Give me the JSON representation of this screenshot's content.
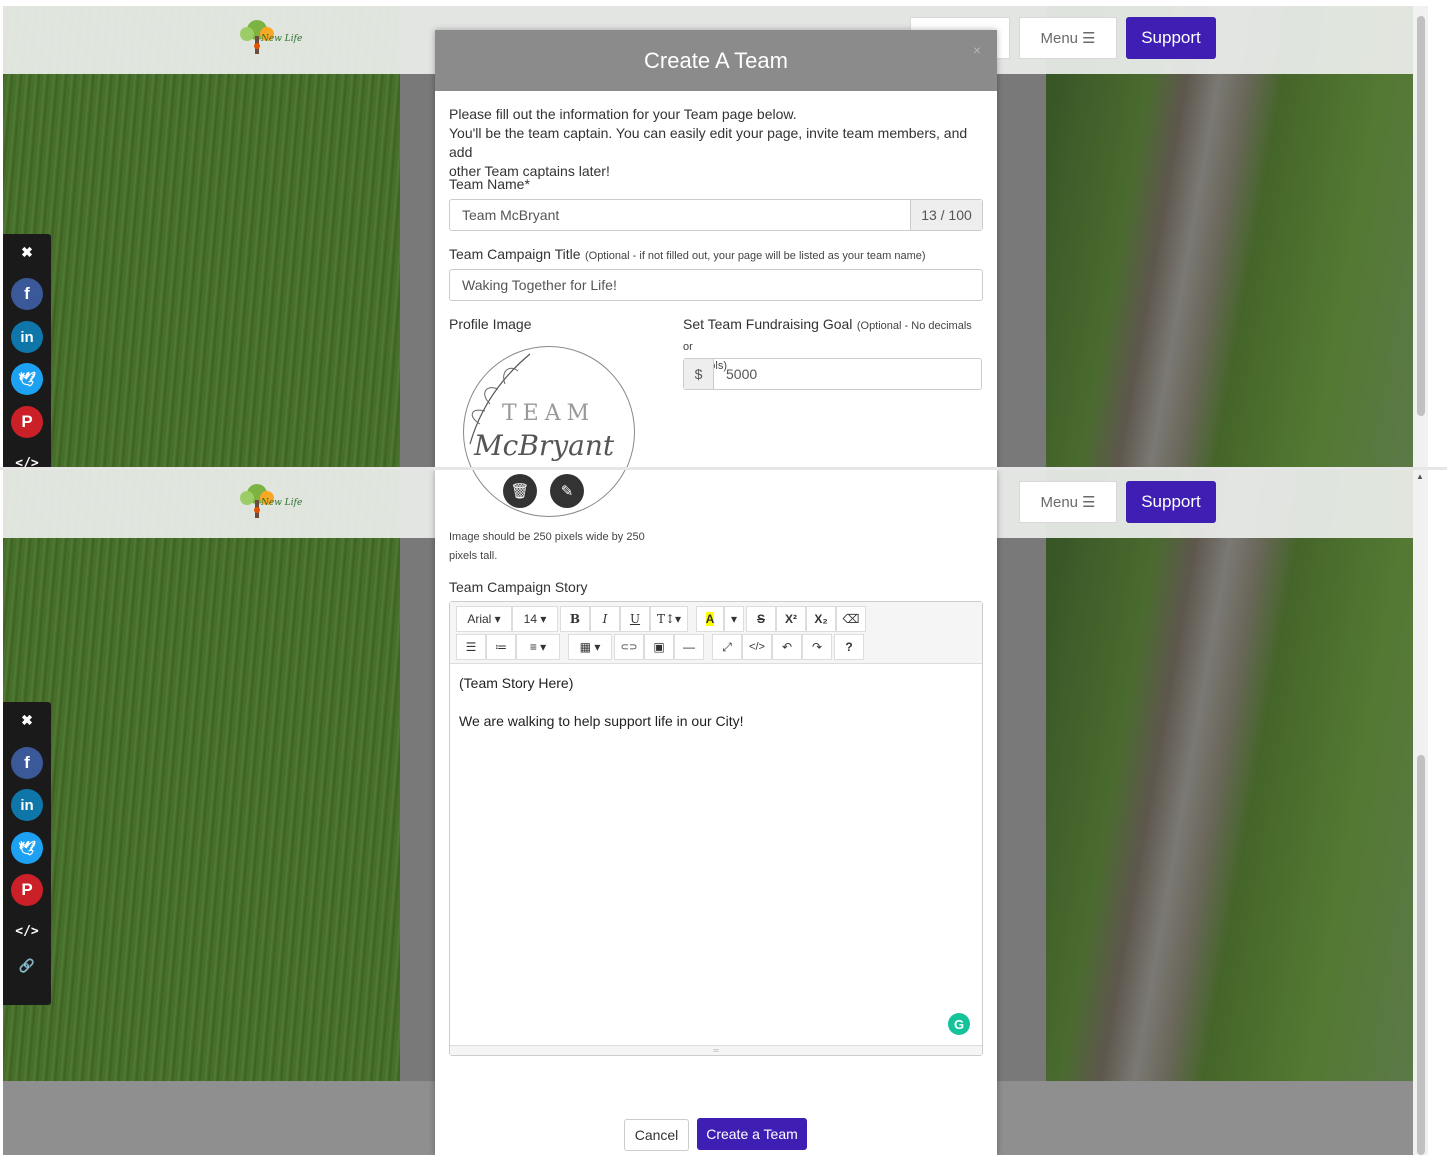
{
  "header": {
    "logo_text": "New Life",
    "menu_label": "Menu",
    "support_label": "Support"
  },
  "social": {
    "close": "✖",
    "embed": "</>",
    "link": "🔗"
  },
  "colors": {
    "brand": "#3f1fb3",
    "facebook": "#3b5998",
    "linkedin": "#0e76a8",
    "twitter": "#1da1f2",
    "pinterest": "#cb2027"
  },
  "modal": {
    "title": "Create A Team",
    "close": "×",
    "intro_1": "Please fill out the information for your Team page below.",
    "intro_2": "You'll be the team captain. You can easily edit your page, invite team members, and add",
    "intro_3": "other Team captains later!",
    "team_name_label": "Team Name*",
    "team_name_value": "Team McBryant",
    "team_name_count": "13 / 100",
    "campaign_title_label": "Team Campaign Title",
    "campaign_title_hint": "(Optional - if not filled out, your page will be listed as your team name)",
    "campaign_title_value": "Waking Together for Life!",
    "profile_image_label": "Profile Image",
    "profile_image_team": "TEAM",
    "profile_image_name": "McBryant",
    "goal_label": "Set Team Fundraising Goal",
    "goal_hint_1": "(Optional - No decimals or",
    "goal_hint_2": "symbols)",
    "goal_currency": "$",
    "goal_value": "5000",
    "image_hint_1": "Image should be 250 pixels wide by 250",
    "image_hint_2": "pixels tall.",
    "story_label": "Team Campaign Story",
    "story_line_1": "(Team Story Here)",
    "story_line_2": "We are walking to help support life in our City!",
    "cancel_label": "Cancel",
    "create_label": "Create a Team"
  },
  "editor": {
    "font": "Arial ▾",
    "size": "14 ▾",
    "bold": "B",
    "italic": "I",
    "underline": "U",
    "text_size": "T↕▾",
    "highlight": "A",
    "caret": "▾",
    "strike": "S",
    "superscript": "X²",
    "subscript": "X₂",
    "eraser": "⌫",
    "bullets": "☰",
    "numbers": "≔",
    "align": "≡ ▾",
    "table": "▦ ▾",
    "link": "⊂⊃",
    "image": "▣",
    "hr": "—",
    "fullscreen": "⤢",
    "code": "</>",
    "undo": "↶",
    "redo": "↷",
    "help": "?"
  }
}
